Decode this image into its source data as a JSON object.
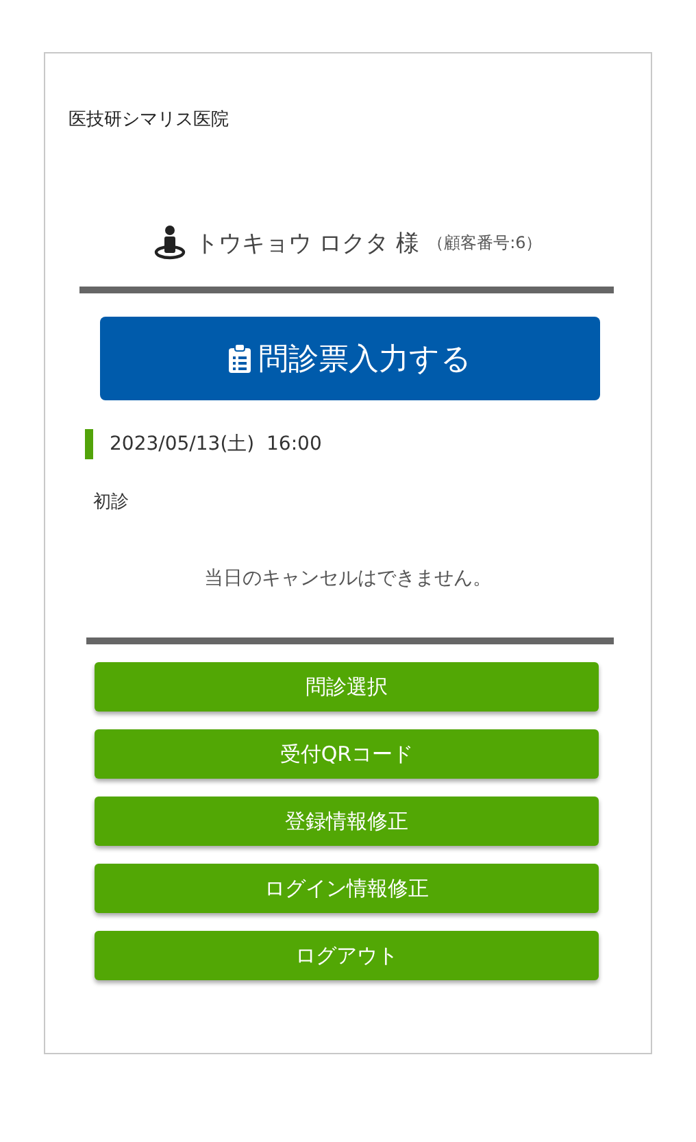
{
  "clinic_name": "医技研シマリス医院",
  "patient": {
    "name": "トウキョウ ロクタ 様",
    "customer_number": "（顧客番号:6）"
  },
  "questionnaire_button": "問診票入力する",
  "appointment": {
    "datetime": "2023/05/13(土)  16:00",
    "visit_type": "初診",
    "note": "当日のキャンセルはできません。"
  },
  "menu_buttons": [
    "問診選択",
    "受付QRコード",
    "登録情報修正",
    "ログイン情報修正",
    "ログアウト"
  ]
}
